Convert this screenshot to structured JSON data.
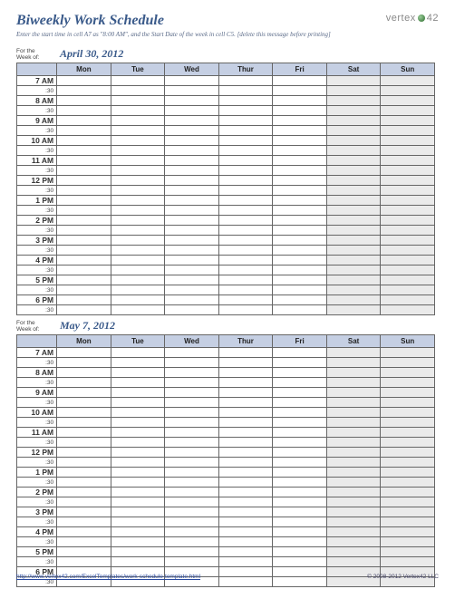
{
  "title": "Biweekly Work Schedule",
  "instruction": "Enter the start time in cell A7 as \"8:00 AM\", and the Start Date of the week in cell C5.  [delete this message before printing]",
  "brand": {
    "name": "vertex",
    "suffix": "42"
  },
  "for_week_label": "For the\nWeek of:",
  "weeks": [
    {
      "date": "April 30, 2012"
    },
    {
      "date": "May 7, 2012"
    }
  ],
  "days": [
    "Mon",
    "Tue",
    "Wed",
    "Thur",
    "Fri",
    "Sat",
    "Sun"
  ],
  "weekend_indices": [
    5,
    6
  ],
  "hours": [
    "7 AM",
    "8 AM",
    "9 AM",
    "10 AM",
    "11 AM",
    "12 PM",
    "1 PM",
    "2 PM",
    "3 PM",
    "4 PM",
    "5 PM",
    "6 PM"
  ],
  "half_label": ":30",
  "footer": {
    "url": "http://www.vertex42.com/ExcelTemplates/work-schedule-template.html",
    "copyright": "© 2008-2012 Vertex42 LLC"
  }
}
